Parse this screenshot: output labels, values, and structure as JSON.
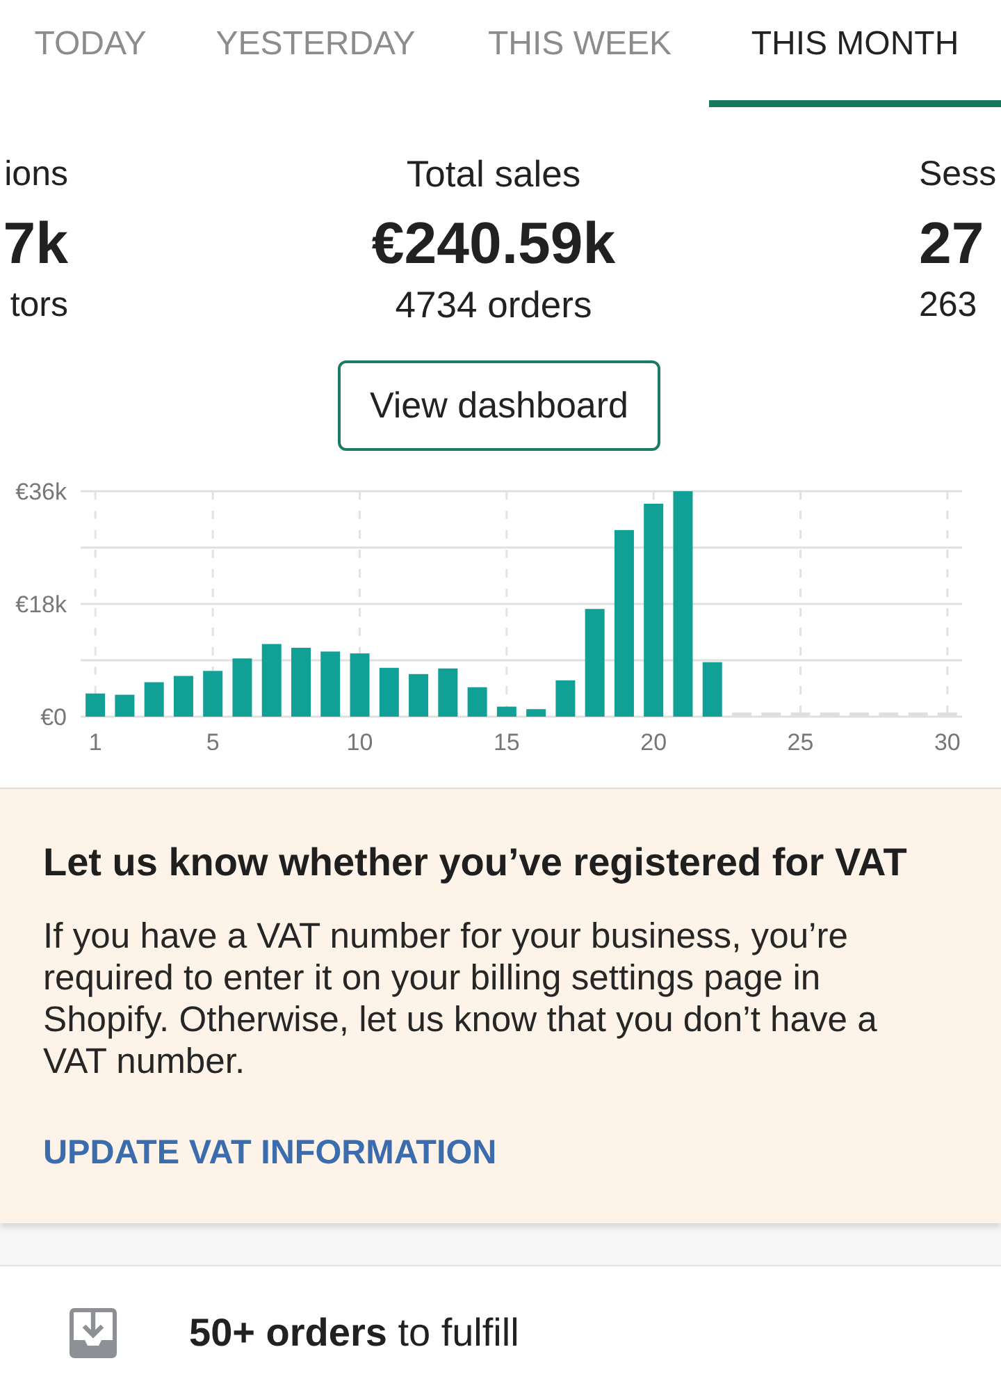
{
  "tabs": [
    {
      "label": "TODAY",
      "selected": false
    },
    {
      "label": "YESTERDAY",
      "selected": false
    },
    {
      "label": "THIS WEEK",
      "selected": false
    },
    {
      "label": "THIS MONTH",
      "selected": true
    }
  ],
  "metrics": [
    {
      "kind": "clipped_left",
      "label": "ions",
      "value": "7k",
      "detail": "tors"
    },
    {
      "kind": "full",
      "label": "Total sales",
      "value": "€240.59k",
      "detail": "4734 orders"
    },
    {
      "kind": "clipped_right",
      "label": "Sess",
      "value": "27",
      "detail": "263"
    }
  ],
  "dashboard_button": {
    "label": "View dashboard"
  },
  "sales_chart": {
    "chart_data": {
      "type": "bar",
      "grid": true,
      "x": [
        1,
        2,
        3,
        4,
        5,
        6,
        7,
        8,
        9,
        10,
        11,
        12,
        13,
        14,
        15,
        16,
        17,
        18,
        19,
        20,
        21,
        22
      ],
      "values": [
        3700,
        3500,
        5500,
        6500,
        7300,
        9300,
        11600,
        11000,
        10400,
        10100,
        7800,
        6800,
        7700,
        4700,
        1600,
        1200,
        5800,
        17200,
        29800,
        34000,
        36000,
        8700
      ],
      "xlim": [
        0.5,
        30.5
      ],
      "ylim": [
        0,
        36000
      ],
      "yticks": [
        {
          "value": 0,
          "label": "€0"
        },
        {
          "value": 18000,
          "label": "€18k"
        },
        {
          "value": 36000,
          "label": "€36k"
        }
      ],
      "xticks": [
        1,
        5,
        10,
        15,
        20,
        25,
        30
      ]
    }
  },
  "vat_notice": {
    "title": "Let us know whether you’ve registered for VAT",
    "body": "If you have a VAT number for your business, you’re required to enter it on your billing settings page in Shopify. Otherwise, let us know that you don’t have a VAT number.",
    "action": "UPDATE VAT INFORMATION"
  },
  "tasks": [
    {
      "text": "**50+ orders** to fulfill"
    }
  ]
}
